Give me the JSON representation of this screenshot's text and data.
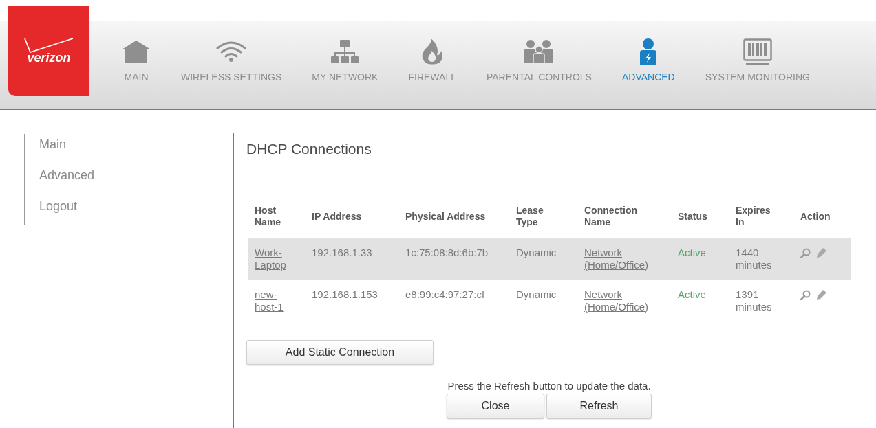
{
  "logo": {
    "text": "verizon"
  },
  "nav": [
    {
      "label": "MAIN",
      "selected": false
    },
    {
      "label": "WIRELESS SETTINGS",
      "selected": false
    },
    {
      "label": "MY NETWORK",
      "selected": false
    },
    {
      "label": "FIREWALL",
      "selected": false
    },
    {
      "label": "PARENTAL CONTROLS",
      "selected": false
    },
    {
      "label": "ADVANCED",
      "selected": true
    },
    {
      "label": "SYSTEM MONITORING",
      "selected": false
    }
  ],
  "sidebar": {
    "items": [
      "Main",
      "Advanced",
      "Logout"
    ]
  },
  "page_title": "DHCP Connections",
  "table": {
    "columns": [
      "Host Name",
      "IP Address",
      "Physical Address",
      "Lease Type",
      "Connection Name",
      "Status",
      "Expires In",
      "Action"
    ],
    "rows": [
      {
        "host_name": "Work-Laptop",
        "ip_address": "192.168.1.33",
        "physical_address": "1c:75:08:8d:6b:7b",
        "lease_type": "Dynamic",
        "connection_name": "Network (Home/Office)",
        "status": "Active",
        "expires_in": "1440 minutes"
      },
      {
        "host_name": "new-host-1",
        "ip_address": "192.168.1.153",
        "physical_address": "e8:99:c4:97:27:cf",
        "lease_type": "Dynamic",
        "connection_name": "Network (Home/Office)",
        "status": "Active",
        "expires_in": "1391 minutes"
      }
    ]
  },
  "add_button": "Add Static Connection",
  "note": "Press the Refresh button to update the data.",
  "buttons": [
    "Close",
    "Refresh"
  ]
}
